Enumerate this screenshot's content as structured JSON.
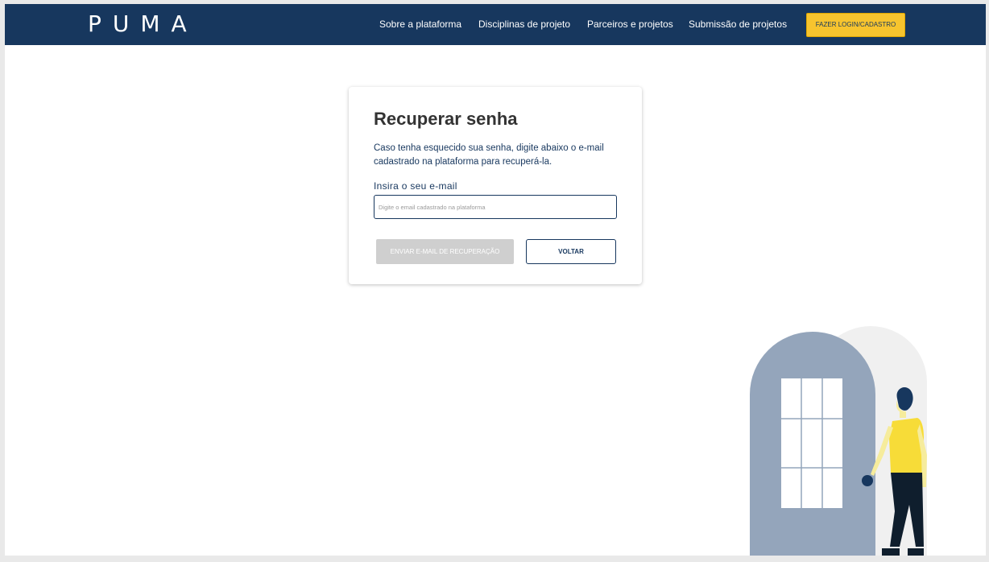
{
  "navbar": {
    "logo": "PUMA",
    "links": [
      "Sobre a plataforma",
      "Disciplinas de projeto",
      "Parceiros e projetos",
      "Submissão de projetos"
    ],
    "login_label": "FAZER LOGIN/CADASTRO"
  },
  "recovery": {
    "title": "Recuperar senha",
    "description": "Caso tenha esquecido sua senha, digite abaixo o e-mail cadastrado na plataforma para recuperá-la.",
    "email_label": "Insira o seu e-mail",
    "email_value": "",
    "email_placeholder": "Digite o email cadastrado na plataforma",
    "send_label": "ENVIAR E-MAIL DE RECUPERAÇÃO",
    "back_label": "VOLTAR"
  },
  "colors": {
    "brand_navy": "#17375e",
    "accent_yellow": "#f7c42e",
    "disabled_gray": "#cfcfcf",
    "door_gray": "#94a5bb"
  },
  "icons": {
    "illustration": "person-at-door-illustration"
  }
}
